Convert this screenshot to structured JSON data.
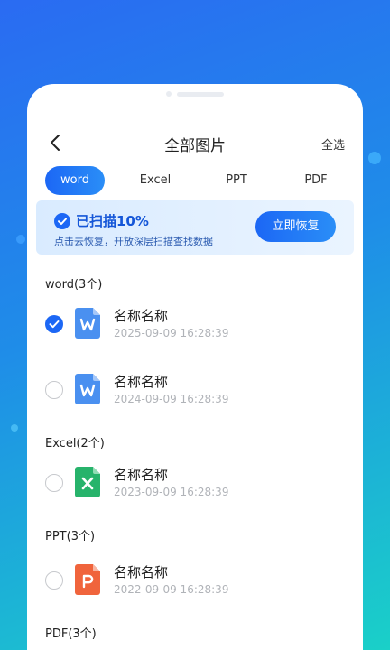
{
  "header": {
    "title": "全部图片",
    "select_all": "全选"
  },
  "tabs": [
    {
      "label": "word",
      "active": true
    },
    {
      "label": "Excel",
      "active": false
    },
    {
      "label": "PPT",
      "active": false
    },
    {
      "label": "PDF",
      "active": false
    }
  ],
  "banner": {
    "status": "已扫描10%",
    "hint": "点击去恢复，开放深层扫描查找数据",
    "button": "立即恢复"
  },
  "sections": [
    {
      "title": "word(3个)",
      "type": "word",
      "items": [
        {
          "name": "名称名称",
          "time": "2025-09-09 16:28:39",
          "checked": true
        },
        {
          "name": "名称名称",
          "time": "2024-09-09 16:28:39",
          "checked": false
        }
      ]
    },
    {
      "title": "Excel(2个)",
      "type": "excel",
      "items": [
        {
          "name": "名称名称",
          "time": "2023-09-09 16:28:39",
          "checked": false
        }
      ]
    },
    {
      "title": "PPT(3个)",
      "type": "ppt",
      "items": [
        {
          "name": "名称名称",
          "time": "2022-09-09 16:28:39",
          "checked": false
        }
      ]
    },
    {
      "title": "PDF(3个)",
      "type": "pdf",
      "items": []
    }
  ],
  "colors": {
    "accent": "#1c67f5",
    "word": "#4a90f0",
    "excel": "#27b36b",
    "ppt": "#f0643c"
  },
  "icons": {
    "back": "chevron-left-icon",
    "check": "check-icon",
    "word": "word-file-icon",
    "excel": "excel-file-icon",
    "ppt": "ppt-file-icon"
  }
}
